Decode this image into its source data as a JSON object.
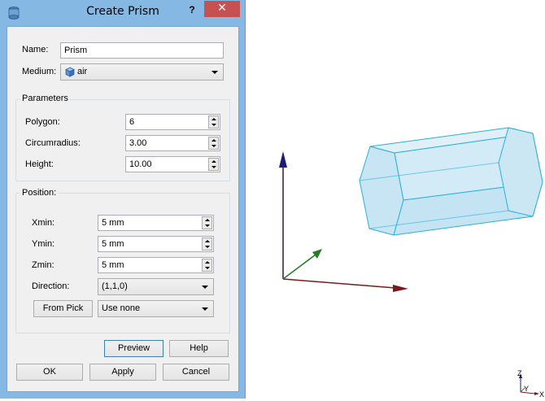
{
  "dialog": {
    "title": "Create Prism",
    "help_glyph": "?",
    "close_glyph": "✕",
    "name": {
      "label": "Name:",
      "value": "Prism"
    },
    "medium": {
      "label": "Medium:",
      "value": "air"
    },
    "parameters": {
      "title": "Parameters",
      "polygon": {
        "label": "Polygon:",
        "value": "6"
      },
      "circumradius": {
        "label": "Circumradius:",
        "value": "3.00"
      },
      "height": {
        "label": "Height:",
        "value": "10.00"
      }
    },
    "position": {
      "title": "Position:",
      "xmin": {
        "label": "Xmin:",
        "value": "5 mm"
      },
      "ymin": {
        "label": "Ymin:",
        "value": "5 mm"
      },
      "zmin": {
        "label": "Zmin:",
        "value": "5 mm"
      },
      "direction": {
        "label": "Direction:",
        "value": "(1,1,0)"
      },
      "from_pick_label": "From Pick",
      "pick_mode": "Use none"
    },
    "buttons": {
      "preview": "Preview",
      "help": "Help",
      "ok": "OK",
      "apply": "Apply",
      "cancel": "Cancel"
    }
  },
  "viewport": {
    "axis_labels": {
      "z": "Z",
      "y": "Y",
      "x": "X"
    },
    "colors": {
      "z_axis": "#1a1a7a",
      "y_axis": "#2a7a2a",
      "x_axis": "#7a1a1a",
      "prism_fill": "#cdeaf5",
      "prism_edge": "#2ab0d8"
    }
  }
}
